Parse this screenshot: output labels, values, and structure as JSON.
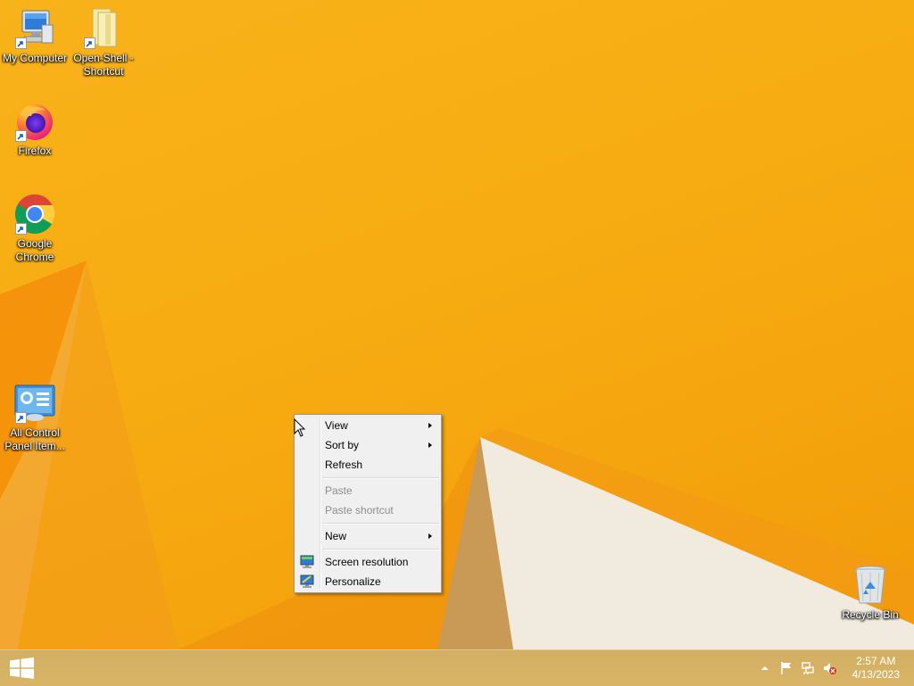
{
  "desktop_icons": [
    {
      "label": "My Computer",
      "icon": "computer-icon"
    },
    {
      "label": "Open-Shell - Shortcut",
      "icon": "folder-icon"
    },
    {
      "label": "Firefox",
      "icon": "firefox-icon"
    },
    {
      "label": "Google Chrome",
      "icon": "chrome-icon"
    },
    {
      "label": "All Control Panel Item...",
      "icon": "control-panel-icon"
    },
    {
      "label": "Recycle Bin",
      "icon": "recycle-bin-icon"
    }
  ],
  "context_menu": {
    "view": "View",
    "sort_by": "Sort by",
    "refresh": "Refresh",
    "paste": "Paste",
    "paste_shortcut": "Paste shortcut",
    "new": "New",
    "screen_resolution": "Screen resolution",
    "personalize": "Personalize"
  },
  "taskbar": {
    "start_icon": "windows-logo-icon",
    "tray_icons": [
      "show-hidden-icons-arrow-icon",
      "action-center-flag-icon",
      "network-icon",
      "volume-muted-icon"
    ],
    "time": "2:57 AM",
    "date": "4/13/2023"
  },
  "colors": {
    "desktop_bg": "#f7ad12",
    "taskbar_bg": "#d0a95a",
    "menu_bg": "#f0f0f0",
    "disabled_text": "#8d8d8d"
  }
}
